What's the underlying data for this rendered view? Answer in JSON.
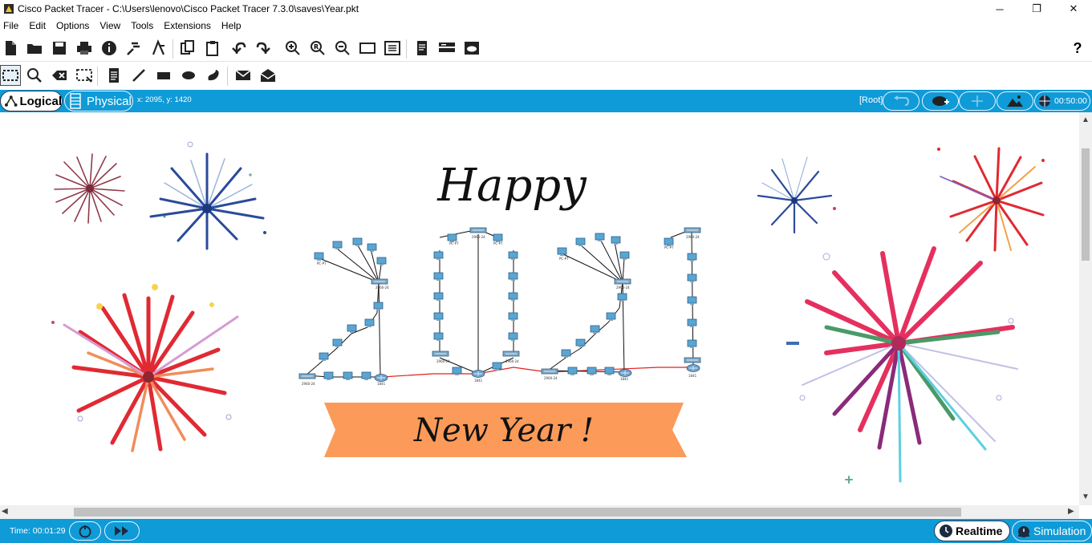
{
  "window": {
    "title": "Cisco Packet Tracer - C:\\Users\\lenovo\\Cisco Packet Tracer 7.3.0\\saves\\Year.pkt",
    "minimize_glyph": "─",
    "maximize_glyph": "❐",
    "close_glyph": "✕"
  },
  "menu": [
    "File",
    "Edit",
    "Options",
    "View",
    "Tools",
    "Extensions",
    "Help"
  ],
  "toolbar": {
    "main_icons": [
      "new-file-icon",
      "open-folder-icon",
      "save-icon",
      "print-icon",
      "info-icon",
      "activity-wizard-icon",
      "custom-activity-icon",
      "copy-icon",
      "paste-icon",
      "undo-icon",
      "redo-icon",
      "zoom-in-icon",
      "zoom-reset-icon",
      "zoom-out-icon",
      "drawing-palette-icon",
      "custom-devices-icon",
      "notes-icon",
      "view-list-icon",
      "cloud-save-icon"
    ],
    "help_label": "?",
    "edit_icons": [
      "select-icon",
      "inspect-icon",
      "delete-icon",
      "resize-shape-icon",
      "place-note-icon",
      "draw-line-icon",
      "draw-rectangle-icon",
      "draw-ellipse-icon",
      "freeform-icon",
      "add-simple-pdu-icon",
      "add-complex-pdu-icon"
    ]
  },
  "workspace": {
    "logical_label": "Logical",
    "physical_label": "Physical",
    "coords": "x: 2095, y: 1420",
    "root_label": "[Root]",
    "clock": "00:50:00"
  },
  "canvas": {
    "happy_text": "Happy",
    "year_text": "New Year !",
    "banner_color": "#fb9a59",
    "device_labels": {
      "switch": "2960-24",
      "pc": "PC-PT",
      "router": "1841"
    }
  },
  "status": {
    "time_label": "Time: 00:01:29",
    "realtime_label": "Realtime",
    "simulation_label": "Simulation"
  },
  "colors": {
    "accent": "#0f9bd7",
    "link_red": "#e02020",
    "link_black": "#111111"
  }
}
